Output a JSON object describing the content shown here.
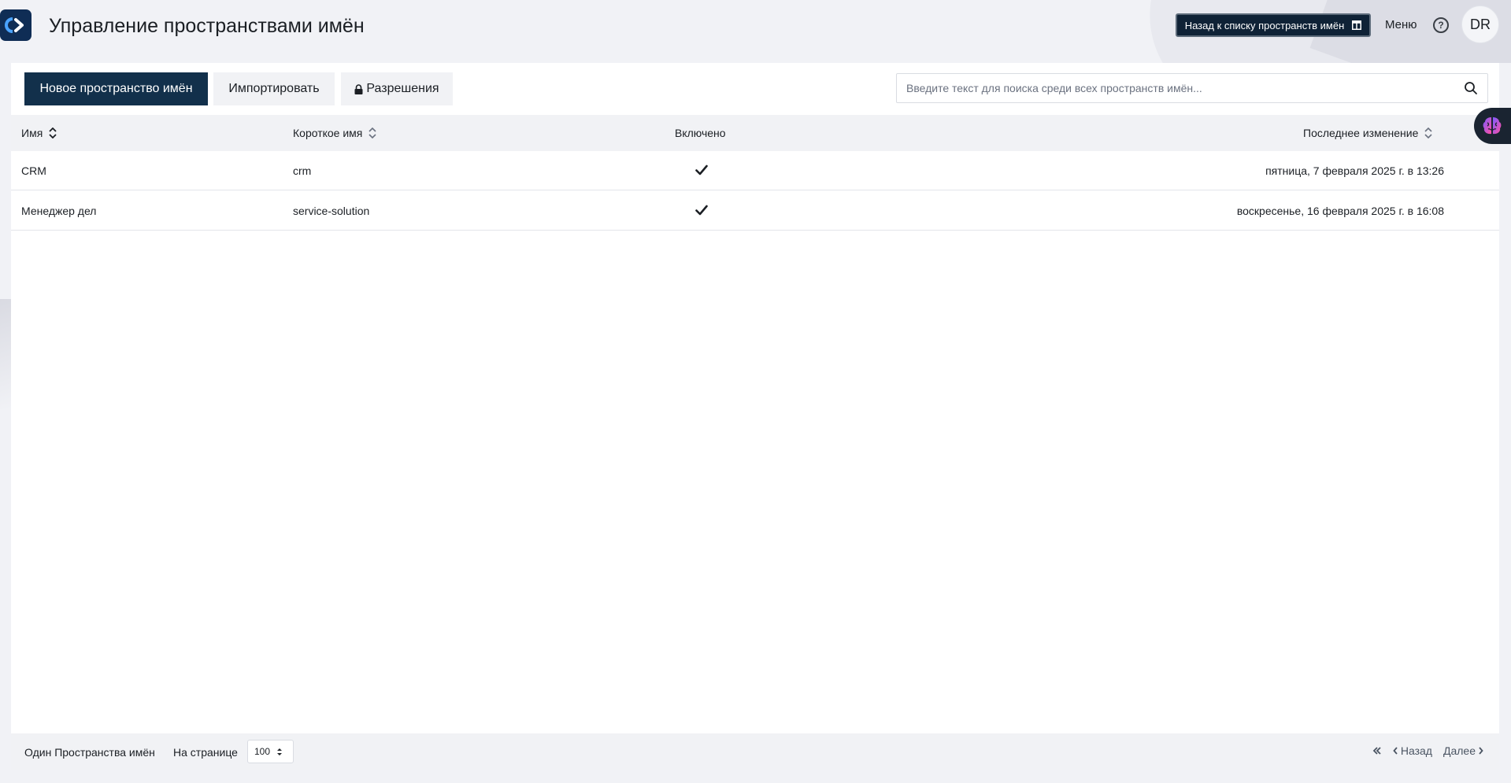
{
  "header": {
    "title": "Управление пространствами имён",
    "back_button": "Назад к списку пространств имён",
    "menu": "Меню",
    "help_icon": "?",
    "avatar_initials": "DR"
  },
  "toolbar": {
    "new_namespace": "Новое пространство имён",
    "import": "Импортировать",
    "permissions": "Разрешения",
    "search_placeholder": "Введите текст для поиска среди всех пространств имён..."
  },
  "table": {
    "columns": {
      "name": "Имя",
      "short_name": "Короткое имя",
      "enabled": "Включено",
      "last_modified": "Последнее изменение"
    },
    "rows": [
      {
        "name": "CRM",
        "short_name": "crm",
        "enabled": true,
        "last_modified": "пятница, 7 февраля 2025 г. в 13:26"
      },
      {
        "name": "Менеджер дел",
        "short_name": "service-solution",
        "enabled": true,
        "last_modified": "воскресенье, 16 февраля 2025 г. в 16:08"
      }
    ]
  },
  "footer": {
    "count_label": "Один Пространства имён",
    "per_page_label": "На странице",
    "per_page_value": "100",
    "prev": "Назад",
    "next": "Далее"
  },
  "colors": {
    "primary": "#12304b",
    "header_button": "#0f2236",
    "table_header_bg": "#f1f2f5"
  }
}
